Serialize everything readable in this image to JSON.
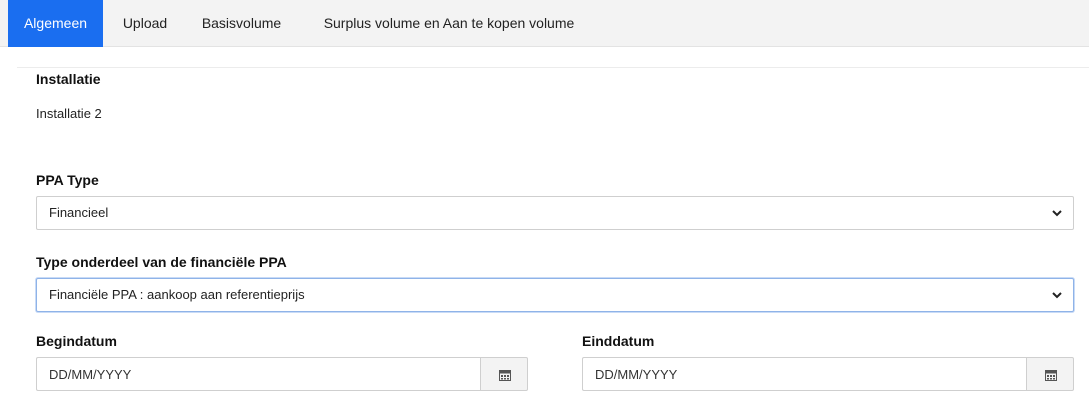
{
  "tabs": [
    {
      "label": "Algemeen",
      "active": true
    },
    {
      "label": "Upload",
      "active": false
    },
    {
      "label": "Basisvolume",
      "active": false
    },
    {
      "label": "Surplus volume en Aan te kopen volume",
      "active": false
    }
  ],
  "installatie": {
    "label": "Installatie",
    "value": "Installatie 2"
  },
  "ppa_type": {
    "label": "PPA Type",
    "selected": "Financieel"
  },
  "type_onderdeel": {
    "label": "Type onderdeel van de financiële PPA",
    "selected": "Financiële PPA : aankoop aan referentieprijs"
  },
  "begindatum": {
    "label": "Begindatum",
    "placeholder": "DD/MM/YYYY"
  },
  "einddatum": {
    "label": "Einddatum",
    "placeholder": "DD/MM/YYYY"
  },
  "colors": {
    "accent": "#1a6ef0",
    "tabbar_bg": "#f3f3f3",
    "border": "#cfcfcf"
  },
  "icons": {
    "dropdown": "chevron-down-icon",
    "date": "calendar-icon"
  }
}
